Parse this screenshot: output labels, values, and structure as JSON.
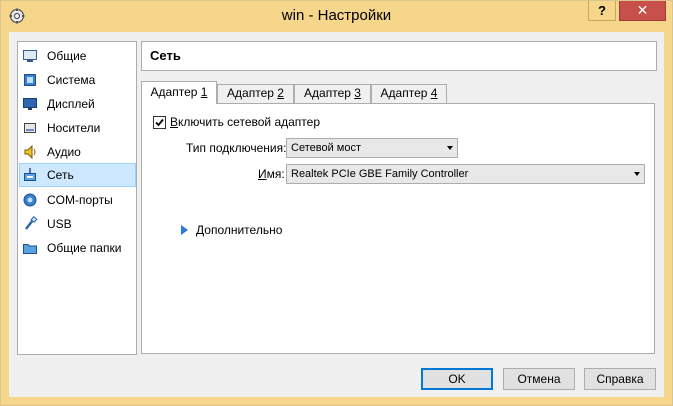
{
  "window": {
    "title": "win - Настройки",
    "help_label": "?",
    "close_label": "✕"
  },
  "sidebar": {
    "items": [
      {
        "label": "Общие",
        "icon": "general-icon"
      },
      {
        "label": "Система",
        "icon": "system-icon"
      },
      {
        "label": "Дисплей",
        "icon": "display-icon"
      },
      {
        "label": "Носители",
        "icon": "storage-icon"
      },
      {
        "label": "Аудио",
        "icon": "audio-icon"
      },
      {
        "label": "Сеть",
        "icon": "network-icon",
        "selected": true
      },
      {
        "label": "COM-порты",
        "icon": "serial-ports-icon"
      },
      {
        "label": "USB",
        "icon": "usb-icon"
      },
      {
        "label": "Общие папки",
        "icon": "shared-folders-icon"
      }
    ]
  },
  "section": {
    "title": "Сеть"
  },
  "tabs": [
    {
      "label": "Адаптер ",
      "accel": "1",
      "active": true
    },
    {
      "label": "Адаптер ",
      "accel": "2"
    },
    {
      "label": "Адаптер ",
      "accel": "3"
    },
    {
      "label": "Адаптер ",
      "accel": "4"
    }
  ],
  "adapter": {
    "enable_accel": "В",
    "enable_label": "ключить сетевой адаптер",
    "enabled": true,
    "attached_label": "Тип подключения:",
    "attached_value": "Сетевой мост",
    "name_label_accel": "И",
    "name_label": "мя:",
    "name_value": "Realtek PCIe GBE Family Controller",
    "advanced_accel": "Д",
    "advanced_label": "ополнительно"
  },
  "buttons": {
    "ok": "OK",
    "cancel": "Отмена",
    "help": "Справка"
  },
  "colors": {
    "titlebar": "#f6d68a",
    "close": "#c7504a",
    "selection": "#cde8ff",
    "accent": "#0078d7"
  }
}
